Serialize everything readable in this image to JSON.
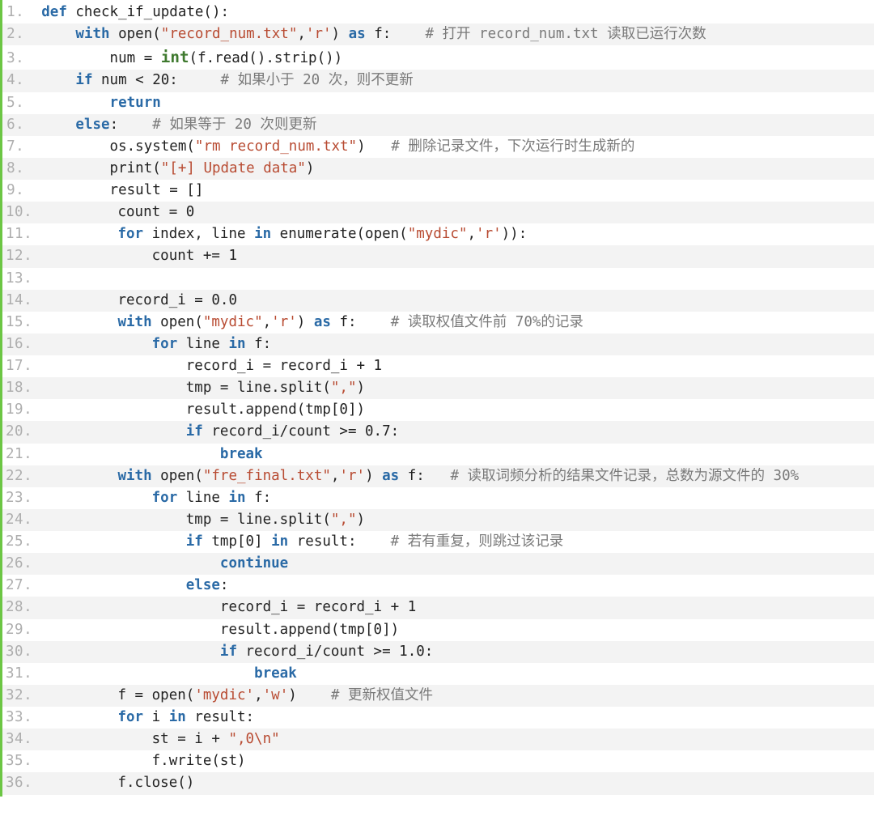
{
  "code": {
    "lines": [
      {
        "n": "1.",
        "ind": "",
        "tokens": [
          {
            "t": "kw",
            "v": "def"
          },
          {
            "t": "p",
            "v": " check_if_update():"
          }
        ]
      },
      {
        "n": "2.",
        "ind": "    ",
        "tokens": [
          {
            "t": "kw",
            "v": "with"
          },
          {
            "t": "p",
            "v": " open("
          },
          {
            "t": "str",
            "v": "\"record_num.txt\""
          },
          {
            "t": "p",
            "v": ","
          },
          {
            "t": "str",
            "v": "'r'"
          },
          {
            "t": "p",
            "v": ") "
          },
          {
            "t": "kw",
            "v": "as"
          },
          {
            "t": "p",
            "v": " f:    "
          },
          {
            "t": "cmt",
            "v": "# 打开 record_num.txt 读取已运行次数"
          }
        ]
      },
      {
        "n": "3.",
        "ind": "        ",
        "tokens": [
          {
            "t": "p",
            "v": "num = "
          },
          {
            "t": "bint",
            "v": "int"
          },
          {
            "t": "p",
            "v": "(f.read().strip())"
          }
        ]
      },
      {
        "n": "4.",
        "ind": "    ",
        "tokens": [
          {
            "t": "kw",
            "v": "if"
          },
          {
            "t": "p",
            "v": " num < 20:     "
          },
          {
            "t": "cmt",
            "v": "# 如果小于 20 次，则不更新"
          }
        ]
      },
      {
        "n": "5.",
        "ind": "        ",
        "tokens": [
          {
            "t": "kw",
            "v": "return"
          }
        ]
      },
      {
        "n": "6.",
        "ind": "    ",
        "tokens": [
          {
            "t": "kw",
            "v": "else"
          },
          {
            "t": "p",
            "v": ":    "
          },
          {
            "t": "cmt",
            "v": "# 如果等于 20 次则更新"
          }
        ]
      },
      {
        "n": "7.",
        "ind": "        ",
        "tokens": [
          {
            "t": "p",
            "v": "os.system("
          },
          {
            "t": "str",
            "v": "\"rm record_num.txt\""
          },
          {
            "t": "p",
            "v": ")   "
          },
          {
            "t": "cmt",
            "v": "# 删除记录文件，下次运行时生成新的"
          }
        ]
      },
      {
        "n": "8.",
        "ind": "        ",
        "tokens": [
          {
            "t": "p",
            "v": "print("
          },
          {
            "t": "str",
            "v": "\"[+] Update data\""
          },
          {
            "t": "p",
            "v": ")"
          }
        ]
      },
      {
        "n": "9.",
        "ind": "        ",
        "tokens": [
          {
            "t": "p",
            "v": "result = []"
          }
        ]
      },
      {
        "n": "10.",
        "ind": "        ",
        "tokens": [
          {
            "t": "p",
            "v": "count = 0"
          }
        ]
      },
      {
        "n": "11.",
        "ind": "        ",
        "tokens": [
          {
            "t": "kw",
            "v": "for"
          },
          {
            "t": "p",
            "v": " index, line "
          },
          {
            "t": "kw",
            "v": "in"
          },
          {
            "t": "p",
            "v": " enumerate(open("
          },
          {
            "t": "str",
            "v": "\"mydic\""
          },
          {
            "t": "p",
            "v": ","
          },
          {
            "t": "str",
            "v": "'r'"
          },
          {
            "t": "p",
            "v": ")):"
          }
        ]
      },
      {
        "n": "12.",
        "ind": "            ",
        "tokens": [
          {
            "t": "p",
            "v": "count += 1"
          }
        ]
      },
      {
        "n": "13.",
        "ind": "",
        "tokens": [
          {
            "t": "p",
            "v": " "
          }
        ]
      },
      {
        "n": "14.",
        "ind": "        ",
        "tokens": [
          {
            "t": "p",
            "v": "record_i = 0.0"
          }
        ]
      },
      {
        "n": "15.",
        "ind": "        ",
        "tokens": [
          {
            "t": "kw",
            "v": "with"
          },
          {
            "t": "p",
            "v": " open("
          },
          {
            "t": "str",
            "v": "\"mydic\""
          },
          {
            "t": "p",
            "v": ","
          },
          {
            "t": "str",
            "v": "'r'"
          },
          {
            "t": "p",
            "v": ") "
          },
          {
            "t": "kw",
            "v": "as"
          },
          {
            "t": "p",
            "v": " f:    "
          },
          {
            "t": "cmt",
            "v": "# 读取权值文件前 70%的记录"
          }
        ]
      },
      {
        "n": "16.",
        "ind": "            ",
        "tokens": [
          {
            "t": "kw",
            "v": "for"
          },
          {
            "t": "p",
            "v": " line "
          },
          {
            "t": "kw",
            "v": "in"
          },
          {
            "t": "p",
            "v": " f:"
          }
        ]
      },
      {
        "n": "17.",
        "ind": "                ",
        "tokens": [
          {
            "t": "p",
            "v": "record_i = record_i + 1"
          }
        ]
      },
      {
        "n": "18.",
        "ind": "                ",
        "tokens": [
          {
            "t": "p",
            "v": "tmp = line.split("
          },
          {
            "t": "str",
            "v": "\",\""
          },
          {
            "t": "p",
            "v": ")"
          }
        ]
      },
      {
        "n": "19.",
        "ind": "                ",
        "tokens": [
          {
            "t": "p",
            "v": "result.append(tmp[0])"
          }
        ]
      },
      {
        "n": "20.",
        "ind": "                ",
        "tokens": [
          {
            "t": "kw",
            "v": "if"
          },
          {
            "t": "p",
            "v": " record_i/count >= 0.7:"
          }
        ]
      },
      {
        "n": "21.",
        "ind": "                    ",
        "tokens": [
          {
            "t": "kw",
            "v": "break"
          }
        ]
      },
      {
        "n": "22.",
        "ind": "        ",
        "tokens": [
          {
            "t": "kw",
            "v": "with"
          },
          {
            "t": "p",
            "v": " open("
          },
          {
            "t": "str",
            "v": "\"fre_final.txt\""
          },
          {
            "t": "p",
            "v": ","
          },
          {
            "t": "str",
            "v": "'r'"
          },
          {
            "t": "p",
            "v": ") "
          },
          {
            "t": "kw",
            "v": "as"
          },
          {
            "t": "p",
            "v": " f:   "
          },
          {
            "t": "cmt",
            "v": "# 读取词频分析的结果文件记录，总数为源文件的 30%"
          }
        ]
      },
      {
        "n": "23.",
        "ind": "            ",
        "tokens": [
          {
            "t": "kw",
            "v": "for"
          },
          {
            "t": "p",
            "v": " line "
          },
          {
            "t": "kw",
            "v": "in"
          },
          {
            "t": "p",
            "v": " f:"
          }
        ]
      },
      {
        "n": "24.",
        "ind": "                ",
        "tokens": [
          {
            "t": "p",
            "v": "tmp = line.split("
          },
          {
            "t": "str",
            "v": "\",\""
          },
          {
            "t": "p",
            "v": ")"
          }
        ]
      },
      {
        "n": "25.",
        "ind": "                ",
        "tokens": [
          {
            "t": "kw",
            "v": "if"
          },
          {
            "t": "p",
            "v": " tmp[0] "
          },
          {
            "t": "kw",
            "v": "in"
          },
          {
            "t": "p",
            "v": " result:    "
          },
          {
            "t": "cmt",
            "v": "# 若有重复，则跳过该记录"
          }
        ]
      },
      {
        "n": "26.",
        "ind": "                    ",
        "tokens": [
          {
            "t": "kw",
            "v": "continue"
          }
        ]
      },
      {
        "n": "27.",
        "ind": "                ",
        "tokens": [
          {
            "t": "kw",
            "v": "else"
          },
          {
            "t": "p",
            "v": ":"
          }
        ]
      },
      {
        "n": "28.",
        "ind": "                    ",
        "tokens": [
          {
            "t": "p",
            "v": "record_i = record_i + 1"
          }
        ]
      },
      {
        "n": "29.",
        "ind": "                    ",
        "tokens": [
          {
            "t": "p",
            "v": "result.append(tmp[0])"
          }
        ]
      },
      {
        "n": "30.",
        "ind": "                    ",
        "tokens": [
          {
            "t": "kw",
            "v": "if"
          },
          {
            "t": "p",
            "v": " record_i/count >= 1.0:"
          }
        ]
      },
      {
        "n": "31.",
        "ind": "                        ",
        "tokens": [
          {
            "t": "kw",
            "v": "break"
          }
        ]
      },
      {
        "n": "32.",
        "ind": "        ",
        "tokens": [
          {
            "t": "p",
            "v": "f = open("
          },
          {
            "t": "str",
            "v": "'mydic'"
          },
          {
            "t": "p",
            "v": ","
          },
          {
            "t": "str",
            "v": "'w'"
          },
          {
            "t": "p",
            "v": ")    "
          },
          {
            "t": "cmt",
            "v": "# 更新权值文件"
          }
        ]
      },
      {
        "n": "33.",
        "ind": "        ",
        "tokens": [
          {
            "t": "kw",
            "v": "for"
          },
          {
            "t": "p",
            "v": " i "
          },
          {
            "t": "kw",
            "v": "in"
          },
          {
            "t": "p",
            "v": " result:"
          }
        ]
      },
      {
        "n": "34.",
        "ind": "            ",
        "tokens": [
          {
            "t": "p",
            "v": "st = i + "
          },
          {
            "t": "str",
            "v": "\",0\\n\""
          }
        ]
      },
      {
        "n": "35.",
        "ind": "            ",
        "tokens": [
          {
            "t": "p",
            "v": "f.write(st)"
          }
        ]
      },
      {
        "n": "36.",
        "ind": "        ",
        "tokens": [
          {
            "t": "p",
            "v": "f.close()"
          }
        ]
      }
    ]
  }
}
